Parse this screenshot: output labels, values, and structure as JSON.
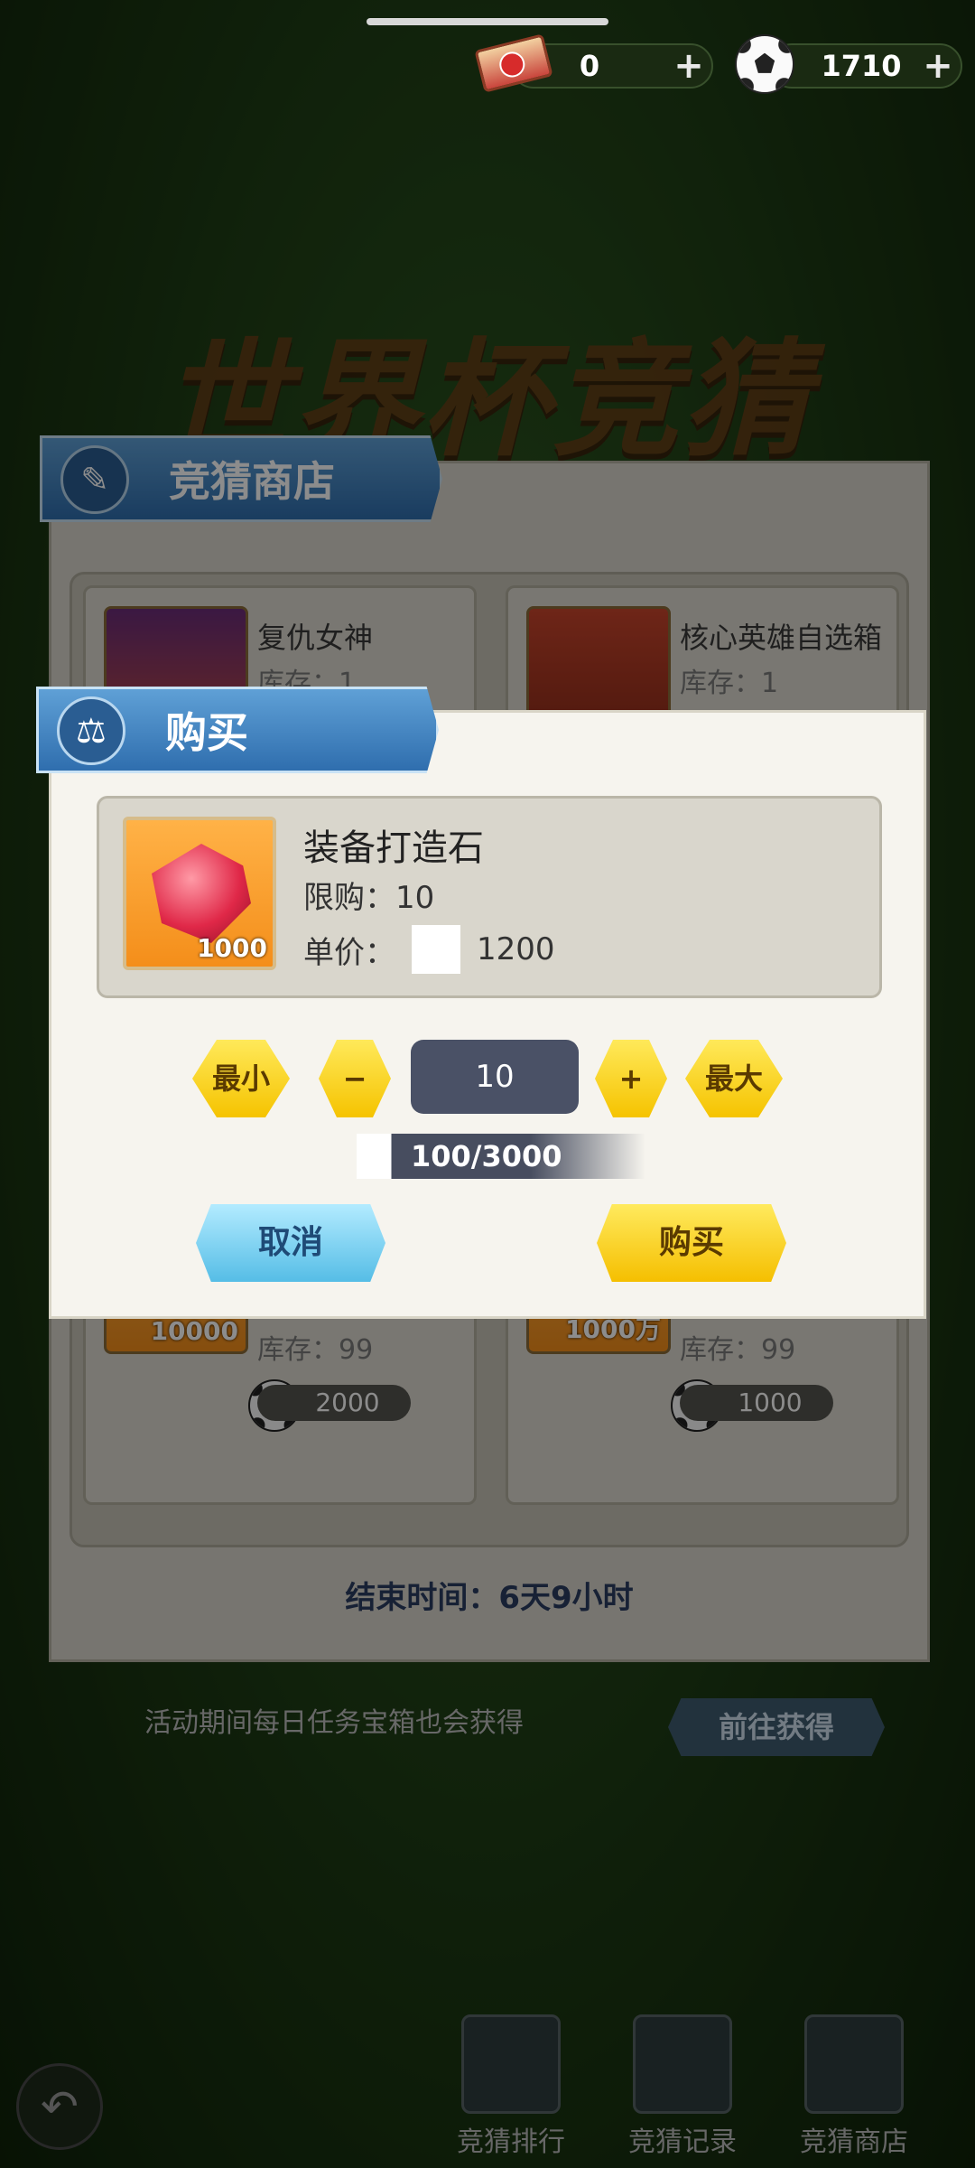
{
  "currency": {
    "tickets": "0",
    "balls": "1710",
    "plus": "+"
  },
  "event_title": "世界杯竞猜",
  "shop": {
    "title": "竞猜商店",
    "items": [
      {
        "name": "复仇女神",
        "stock": "库存：1"
      },
      {
        "name": "核心英雄自选箱",
        "stock": "库存：1"
      },
      {
        "stock": "库存：99",
        "count": "10000",
        "price": "2000"
      },
      {
        "stock": "库存：99",
        "count": "1000万",
        "price": "1000"
      }
    ],
    "end_time": "结束时间：6天9小时"
  },
  "dialog": {
    "title": "购买",
    "item": {
      "name": "装备打造石",
      "limit": "限购：10",
      "price_label": "单价：",
      "price": "1200",
      "count": "1000"
    },
    "min_label": "最小",
    "minus_label": "−",
    "quantity": "10",
    "plus_label": "+",
    "max_label": "最大",
    "progress": "100/3000",
    "cancel_label": "取消",
    "buy_label": "购买"
  },
  "tip": {
    "text": "活动期间每日任务宝箱也会获得",
    "goto_label": "前往获得"
  },
  "nav": {
    "ranking": "竞猜排行",
    "records": "竞猜记录",
    "shop": "竞猜商店"
  }
}
